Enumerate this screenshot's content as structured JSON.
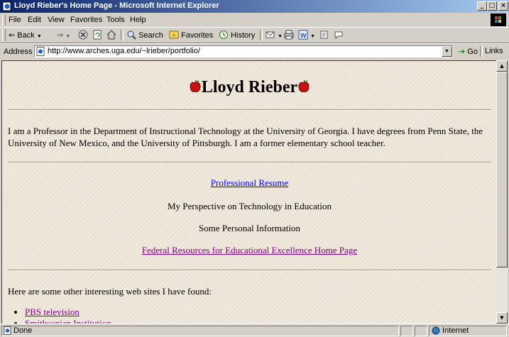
{
  "window": {
    "title": "Lloyd Rieber's Home Page - Microsoft Internet Explorer"
  },
  "menu": {
    "items": [
      "File",
      "Edit",
      "View",
      "Favorites",
      "Tools",
      "Help"
    ]
  },
  "toolbar": {
    "back_label": "Back",
    "search_label": "Search",
    "favorites_label": "Favorites",
    "history_label": "History"
  },
  "address_bar": {
    "label": "Address",
    "url": "http://www.arches.uga.edu/~lrieber/portfolio/",
    "go_label": "Go",
    "links_label": "Links"
  },
  "page": {
    "heading": "Lloyd Rieber",
    "intro": "I am a Professor in the Department of Instructional Technology at the University of Georgia. I have degrees from Penn State, the University of New Mexico, and the University of Pittsburgh. I am a former elementary school teacher.",
    "menu_links": [
      {
        "text": "Professional Resume",
        "kind": "link"
      },
      {
        "text": "My Perspective on Technology in Education",
        "kind": "text"
      },
      {
        "text": "Some Personal Information",
        "kind": "text"
      },
      {
        "text": "Federal Resources for Educational Excellence Home Page",
        "kind": "visited-link"
      }
    ],
    "sites_intro": "Here are some other interesting web sites I have found:",
    "sites": [
      "PBS television",
      "Smithsonian Institution"
    ]
  },
  "status": {
    "text": "Done",
    "zone": "Internet"
  },
  "colors": {
    "link": "#0000ee",
    "visited": "#800080",
    "title_bar_start": "#0a246a",
    "title_bar_end": "#a6caf0"
  }
}
